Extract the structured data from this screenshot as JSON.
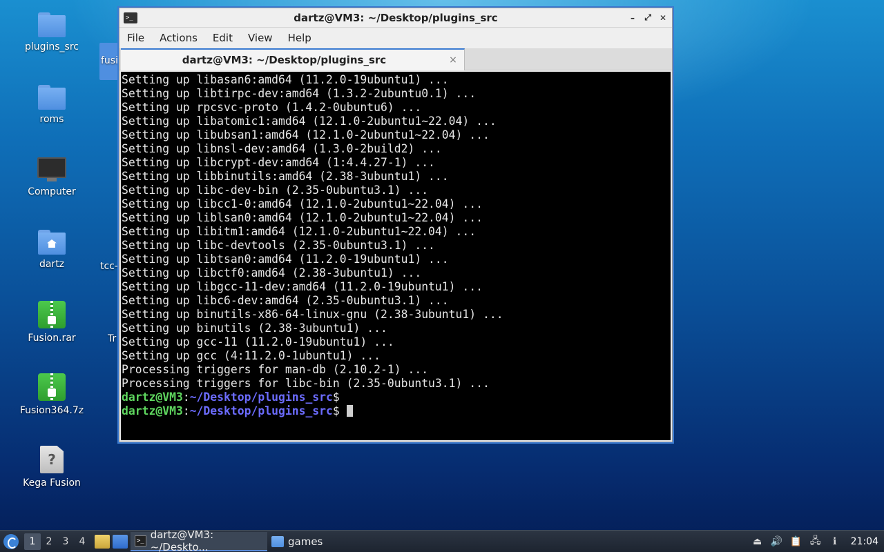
{
  "desktop": {
    "icons": [
      {
        "label": "plugins_src",
        "icon": "folder-icon"
      },
      {
        "label": "roms",
        "icon": "folder-icon"
      },
      {
        "label": "Computer",
        "icon": "computer-icon"
      },
      {
        "label": "dartz",
        "icon": "home-folder-icon"
      },
      {
        "label": "Fusion.rar",
        "icon": "archive-icon"
      },
      {
        "label": "Fusion364.7z",
        "icon": "archive-icon"
      },
      {
        "label": "Kega Fusion",
        "icon": "unknown-file-icon"
      }
    ],
    "partial_labels": [
      "fusi",
      "tcc-",
      "Tr"
    ]
  },
  "window": {
    "title": "dartz@VM3: ~/Desktop/plugins_src",
    "controls": [
      "–",
      "⤢",
      "✕"
    ],
    "menu": [
      "File",
      "Actions",
      "Edit",
      "View",
      "Help"
    ],
    "tab": {
      "title": "dartz@VM3: ~/Desktop/plugins_src",
      "close": "×"
    }
  },
  "terminal": {
    "lines": [
      "Setting up libasan6:amd64 (11.2.0-19ubuntu1) ...",
      "Setting up libtirpc-dev:amd64 (1.3.2-2ubuntu0.1) ...",
      "Setting up rpcsvc-proto (1.4.2-0ubuntu6) ...",
      "Setting up libatomic1:amd64 (12.1.0-2ubuntu1~22.04) ...",
      "Setting up libubsan1:amd64 (12.1.0-2ubuntu1~22.04) ...",
      "Setting up libnsl-dev:amd64 (1.3.0-2build2) ...",
      "Setting up libcrypt-dev:amd64 (1:4.4.27-1) ...",
      "Setting up libbinutils:amd64 (2.38-3ubuntu1) ...",
      "Setting up libc-dev-bin (2.35-0ubuntu3.1) ...",
      "Setting up libcc1-0:amd64 (12.1.0-2ubuntu1~22.04) ...",
      "Setting up liblsan0:amd64 (12.1.0-2ubuntu1~22.04) ...",
      "Setting up libitm1:amd64 (12.1.0-2ubuntu1~22.04) ...",
      "Setting up libc-devtools (2.35-0ubuntu3.1) ...",
      "Setting up libtsan0:amd64 (11.2.0-19ubuntu1) ...",
      "Setting up libctf0:amd64 (2.38-3ubuntu1) ...",
      "Setting up libgcc-11-dev:amd64 (11.2.0-19ubuntu1) ...",
      "Setting up libc6-dev:amd64 (2.35-0ubuntu3.1) ...",
      "Setting up binutils-x86-64-linux-gnu (2.38-3ubuntu1) ...",
      "Setting up binutils (2.38-3ubuntu1) ...",
      "Setting up gcc-11 (11.2.0-19ubuntu1) ...",
      "Setting up gcc (4:11.2.0-1ubuntu1) ...",
      "Processing triggers for man-db (2.10.2-1) ...",
      "Processing triggers for libc-bin (2.35-0ubuntu3.1) ..."
    ],
    "prompts": [
      {
        "user": "dartz@VM3",
        "sep": ":",
        "path": "~/Desktop/plugins_src",
        "symbol": "$"
      },
      {
        "user": "dartz@VM3",
        "sep": ":",
        "path": "~/Desktop/plugins_src",
        "symbol": "$"
      }
    ]
  },
  "taskbar": {
    "workspaces": [
      "1",
      "2",
      "3",
      "4"
    ],
    "active_workspace": "1",
    "tasks": [
      {
        "label": "dartz@VM3: ~/Deskto...",
        "icon": "terminal-icon"
      },
      {
        "label": "games",
        "icon": "folder-icon"
      }
    ],
    "clock": "21:04"
  }
}
